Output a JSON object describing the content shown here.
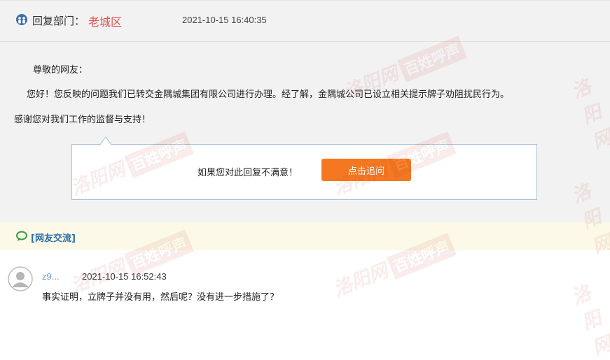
{
  "reply": {
    "dept_label": "回复部门：",
    "dept_name": "老城区",
    "time": "2021-10-15 16:40:35",
    "greeting": "尊敬的网友：",
    "body_line1": "您好！您反映的问题我们已转交金隅城集团有限公司进行办理。经了解，金隅城公司已设立相关提示牌子劝阻扰民行为。",
    "body_line2": "感谢您对我们工作的监督与支持！"
  },
  "feedback": {
    "prompt": "如果您对此回复不满意！",
    "button_label": "点击追问"
  },
  "section": {
    "title": "[网友交流]"
  },
  "comment": {
    "user": "z9...",
    "time": "2021-10-15 16:52:43",
    "text": "事实证明，立牌子并没有用，然后呢？没有进一步措施了？"
  },
  "watermark": {
    "text_script": "洛阳网",
    "text_badge": "百姓呼声"
  },
  "colors": {
    "dept_name": "#d9534f",
    "button": "#f47821",
    "section_title": "#2d6ea8",
    "username": "#6d9bc9"
  }
}
